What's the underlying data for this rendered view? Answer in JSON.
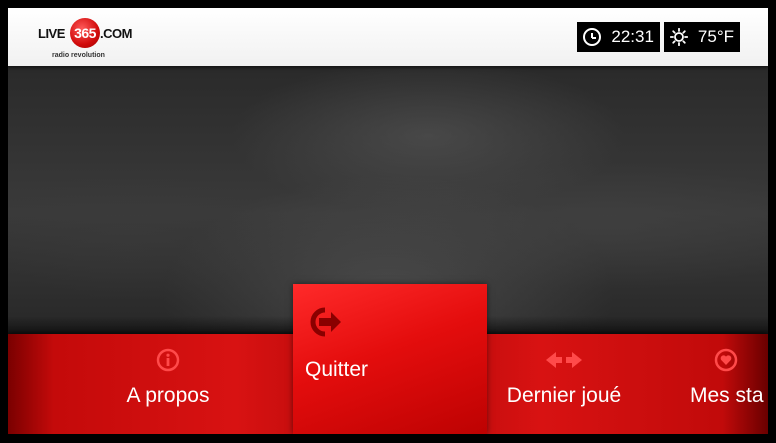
{
  "header": {
    "logo": {
      "live": "LIVE",
      "number": "365",
      "dotcom": ".COM",
      "tagline": "radio revolution"
    },
    "clock": {
      "icon": "clock-icon",
      "time": "22:31"
    },
    "weather": {
      "icon": "sun-icon",
      "temperature": "75°F"
    }
  },
  "menu": {
    "items": [
      {
        "label": "A propos",
        "icon": "info-icon"
      },
      {
        "label": "Quitter",
        "icon": "exit-icon",
        "selected": true
      },
      {
        "label": "Dernier joué",
        "icon": "arrows-icon"
      },
      {
        "label": "Mes sta",
        "icon": "heart-icon"
      }
    ]
  },
  "colors": {
    "accent_red": "#d81212",
    "selected_red": "#e40d0d",
    "icon_dark_red": "#8a0000",
    "icon_bright_red": "#ff4a4a"
  }
}
